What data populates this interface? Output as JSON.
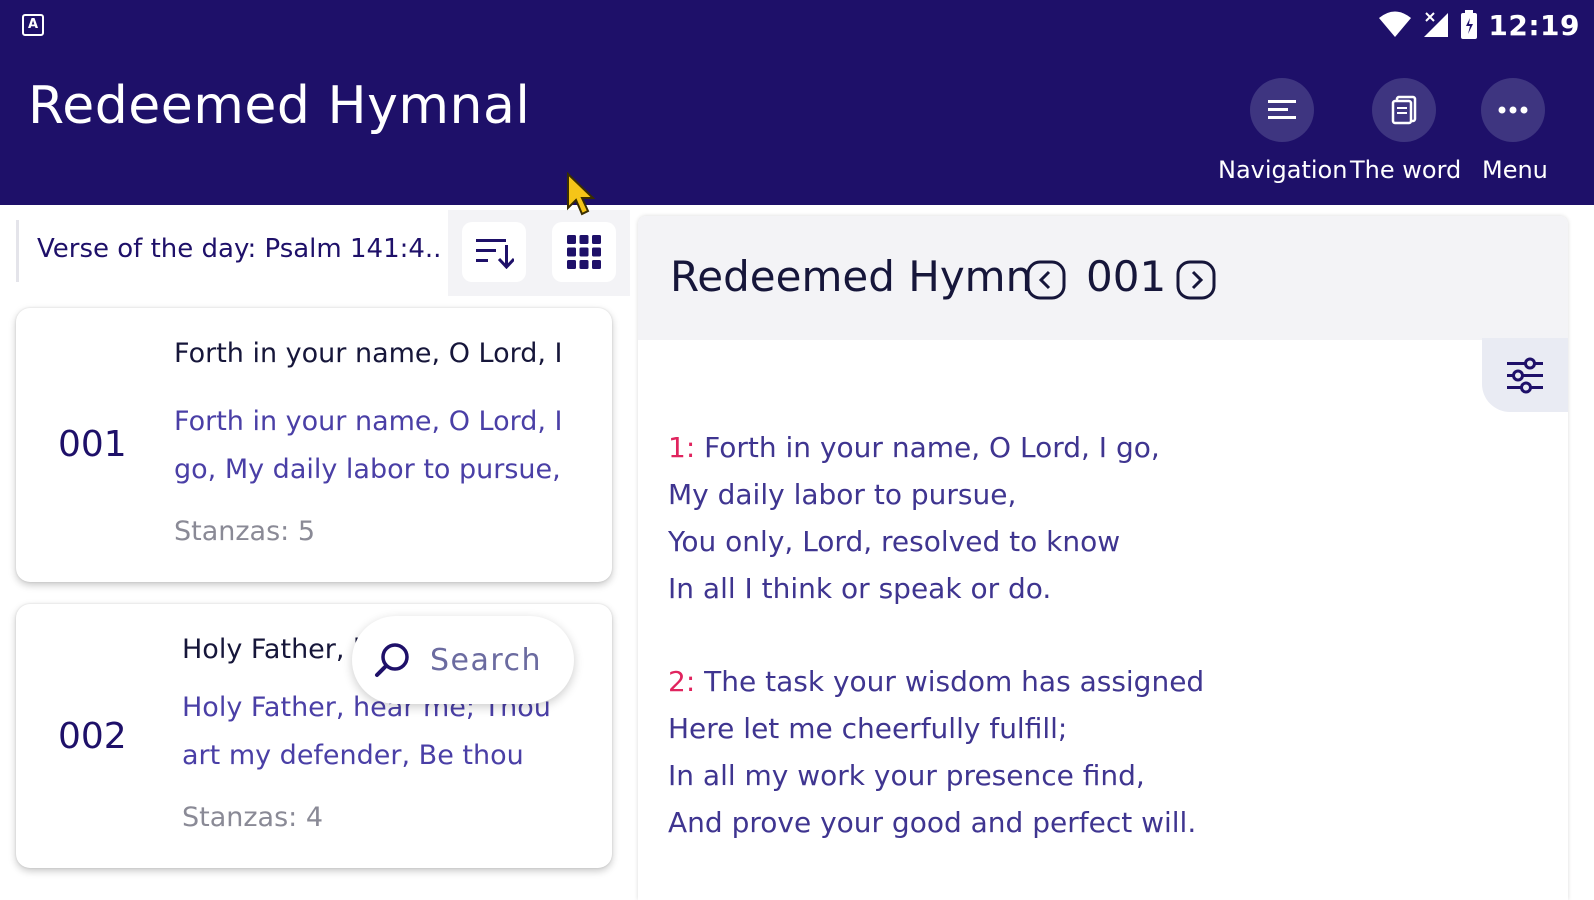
{
  "status_bar": {
    "time": "12:19",
    "left_icon_letter": "A"
  },
  "app": {
    "title": "Redeemed Hymnal"
  },
  "actions": [
    {
      "label": "Navigation",
      "icon": "lines-icon"
    },
    {
      "label": "The word",
      "icon": "book-icon"
    },
    {
      "label": "Menu",
      "icon": "more-dots-icon"
    }
  ],
  "verse_bar": {
    "text": "Verse of the day: Psalm 141:4.."
  },
  "hymn_list": [
    {
      "number": "001",
      "title": "Forth in your name, O Lord, I",
      "preview": "Forth in your name, O Lord, I go,  My daily labor to pursue,",
      "stanzas": "Stanzas: 5"
    },
    {
      "number": "002",
      "title": "Holy Father, h",
      "preview": "Holy Father, hear me;  Thou art my defender, Be thou",
      "stanzas": "Stanzas: 4"
    }
  ],
  "search": {
    "label": "Search"
  },
  "hymn_view": {
    "title": "Redeemed Hymn",
    "number": "001",
    "stanzas": [
      {
        "num": "1:",
        "lines": [
          "Forth in your name, O Lord, I go,",
          "My daily labor to pursue,",
          "You only, Lord, resolved to know",
          "In all I think or speak or do."
        ]
      },
      {
        "num": "2:",
        "lines": [
          "The task your wisdom has assigned",
          "Here let me cheerfully fulfill;",
          "In all my work your presence find,",
          "And prove your good and perfect will."
        ]
      }
    ]
  },
  "colors": {
    "app_bar": "#1e1069",
    "accent_text": "#4a3fa6",
    "stanza_number": "#e0245e"
  }
}
